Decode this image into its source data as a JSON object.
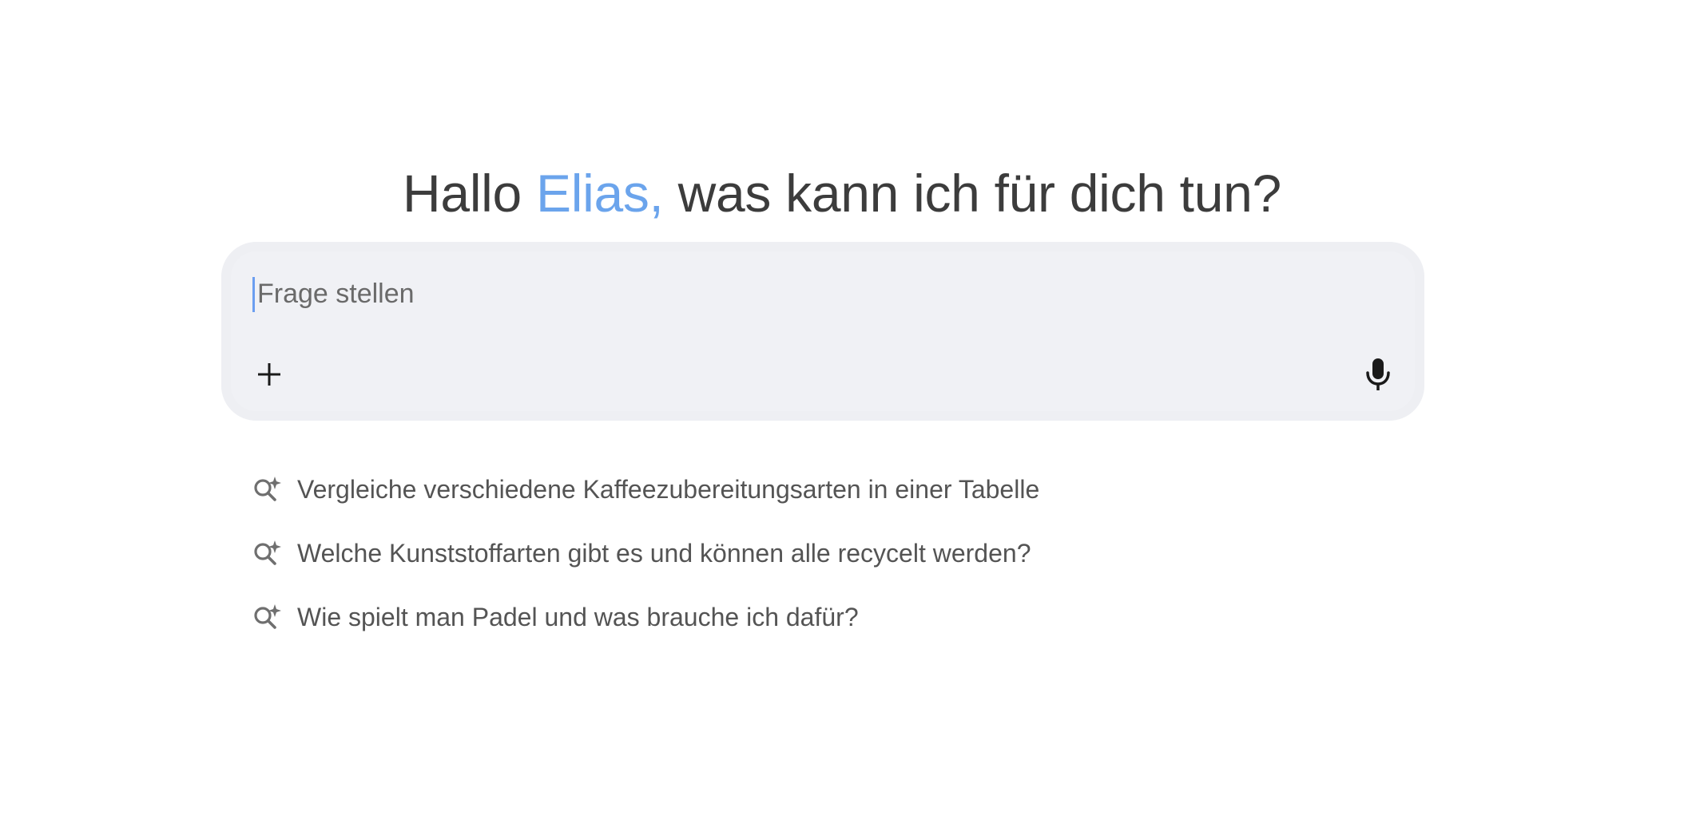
{
  "greeting": {
    "prefix": "Hallo ",
    "name": "Elias,",
    "suffix": " was kann ich für dich tun?"
  },
  "composer": {
    "placeholder": "Frage stellen",
    "value": "",
    "add_icon": "plus-icon",
    "mic_icon": "microphone-icon"
  },
  "suggestions": [
    {
      "icon": "search-sparkle-icon",
      "text": "Vergleiche verschiedene Kaffeezubereitungsarten in einer Tabelle"
    },
    {
      "icon": "search-sparkle-icon",
      "text": "Welche Kunststoffarten gibt es und können alle recycelt werden?"
    },
    {
      "icon": "search-sparkle-icon",
      "text": "Wie spielt man Padel und was brauche ich dafür?"
    }
  ],
  "colors": {
    "accent_name": "#6ba4ec",
    "heading": "#3c3c3c",
    "composer_bg": "#f0f1f5",
    "caret": "#6b9ef0"
  }
}
